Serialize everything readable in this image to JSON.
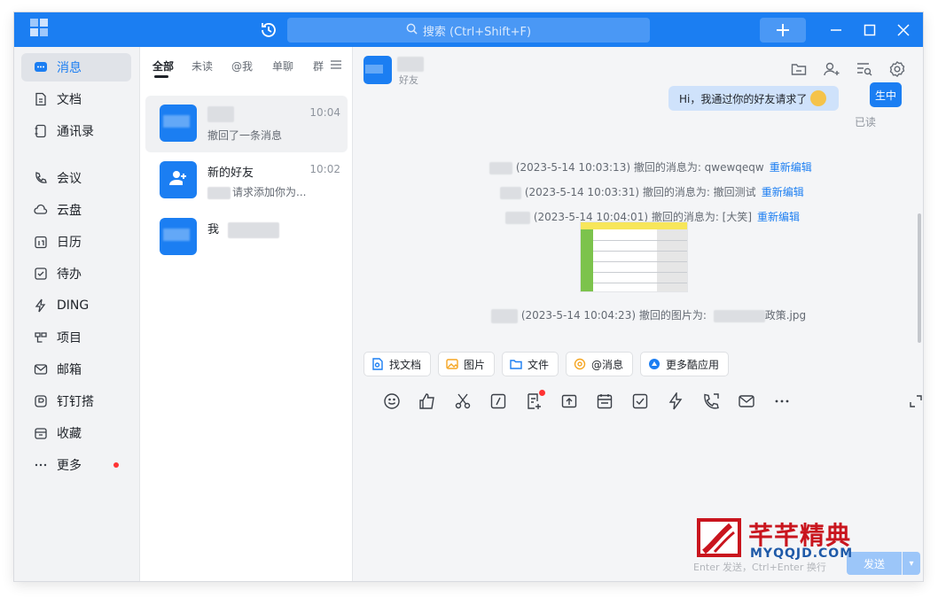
{
  "titlebar": {
    "search_placeholder": "搜索 (Ctrl+Shift+F)",
    "accent": "#1b7ef2"
  },
  "nav": {
    "items": [
      {
        "label": "消息",
        "icon": "chat-icon",
        "active": true
      },
      {
        "label": "文档",
        "icon": "document-icon"
      },
      {
        "label": "通讯录",
        "icon": "contacts-icon"
      },
      {
        "label": "会议",
        "icon": "phone-icon"
      },
      {
        "label": "云盘",
        "icon": "cloud-icon"
      },
      {
        "label": "日历",
        "icon": "calendar-icon"
      },
      {
        "label": "待办",
        "icon": "todo-icon"
      },
      {
        "label": "DING",
        "icon": "lightning-icon"
      },
      {
        "label": "项目",
        "icon": "project-icon"
      },
      {
        "label": "邮箱",
        "icon": "mail-icon"
      },
      {
        "label": "钉钉搭",
        "icon": "builder-icon"
      },
      {
        "label": "收藏",
        "icon": "favorite-icon"
      },
      {
        "label": "更多",
        "icon": "more-icon",
        "badge_dot": true
      }
    ]
  },
  "conv_list": {
    "tabs": [
      "全部",
      "未读",
      "@我",
      "单聊",
      "群"
    ],
    "items": [
      {
        "name": "",
        "time": "10:04",
        "preview": "撤回了一条消息",
        "selected": true
      },
      {
        "name": "新的好友",
        "time": "10:02",
        "preview": "请求添加你为..."
      },
      {
        "name": "我",
        "time": "",
        "preview": ""
      }
    ]
  },
  "chat": {
    "subtitle": "好友",
    "header_icons": [
      "folder-icon",
      "add-member-icon",
      "search-messages-icon",
      "settings-icon"
    ],
    "bubble_text": "Hi，我通过你的好友请求了",
    "bubble_avatar_text": "生中",
    "read_status": "已读",
    "system_lines": [
      {
        "text": "(2023-5-14 10:03:13) 撤回的消息为: qwewqeqw",
        "link": "重新编辑"
      },
      {
        "text": "(2023-5-14 10:03:31) 撤回的消息为: 撤回测试",
        "link": "重新编辑"
      },
      {
        "text": "(2023-5-14 10:04:01) 撤回的消息为: [大笑]",
        "link": "重新编辑"
      },
      {
        "text": "(2023-5-14 10:04:23) 撤回的图片为:",
        "suffix": "政策.jpg"
      }
    ],
    "quick_actions": [
      {
        "label": "找文档",
        "icon": "find-doc-icon",
        "color": "#1b7ef2"
      },
      {
        "label": "图片",
        "icon": "image-icon",
        "color": "#f5a623"
      },
      {
        "label": "文件",
        "icon": "file-icon",
        "color": "#1b7ef2"
      },
      {
        "label": "@消息",
        "icon": "mention-icon",
        "color": "#f5a623"
      },
      {
        "label": "更多酷应用",
        "icon": "apps-icon",
        "color": "#1b7ef2"
      }
    ],
    "toolbar_icons": [
      "emoji-icon",
      "like-icon",
      "scissors-icon",
      "slash-icon",
      "form-icon",
      "upload-icon",
      "schedule-icon",
      "check-icon",
      "ding-icon",
      "call-icon",
      "mail-icon",
      "more-icon"
    ],
    "send_hint": "Enter 发送，Ctrl+Enter 换行",
    "send_label": "发送"
  },
  "watermark": {
    "title": "芊芊精典",
    "subtitle": "MYQQJD.COM"
  }
}
